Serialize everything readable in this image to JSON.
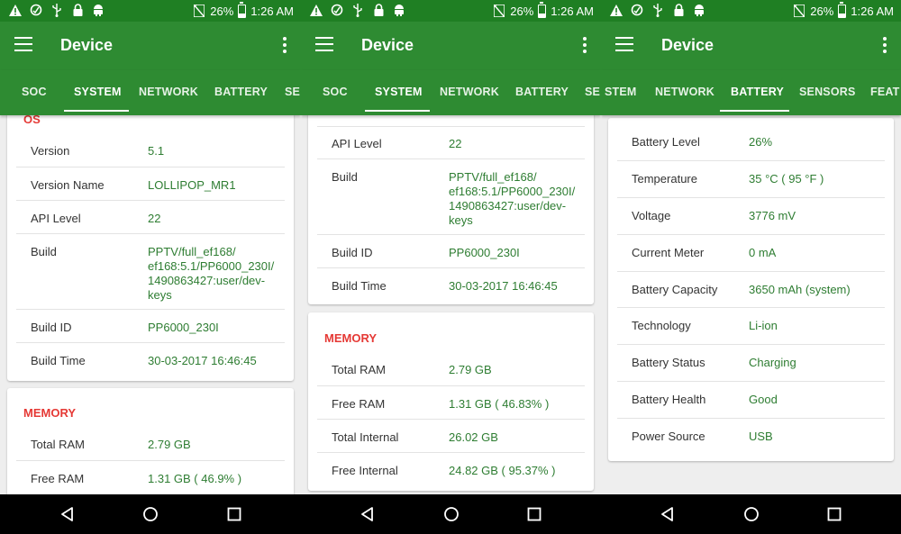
{
  "status_bar": {
    "battery_percent": "26%",
    "time": "1:26 AM",
    "icons": [
      "alert-icon",
      "data-saver-icon",
      "usb-icon",
      "lock-icon",
      "android-icon",
      "no-sim-icon",
      "battery-charging-icon"
    ]
  },
  "app_bar": {
    "title": "Device",
    "menu_icon": "hamburger-menu-icon",
    "overflow_icon": "more-vertical-icon"
  },
  "tabs": {
    "panel1": [
      "SOC",
      "SYSTEM",
      "NETWORK",
      "BATTERY",
      "SE"
    ],
    "panel2": [
      "SOC",
      "SYSTEM",
      "NETWORK",
      "BATTERY",
      "SE"
    ],
    "panel3": [
      "STEM",
      "NETWORK",
      "BATTERY",
      "SENSORS",
      "FEAT"
    ]
  },
  "panel1": {
    "os_title": "OS",
    "os_rows": [
      {
        "label": "Version",
        "value": "5.1"
      },
      {
        "label": "Version Name",
        "value": "LOLLIPOP_MR1"
      },
      {
        "label": "API Level",
        "value": "22"
      },
      {
        "label": "Build",
        "value": "PPTV/full_ef168/ ef168:5.1/PP6000_230I/ 1490863427:user/dev-keys"
      },
      {
        "label": "Build ID",
        "value": "PP6000_230I"
      },
      {
        "label": "Build Time",
        "value": "30-03-2017 16:46:45"
      }
    ],
    "memory_title": "MEMORY",
    "memory_rows": [
      {
        "label": "Total RAM",
        "value": "2.79 GB"
      },
      {
        "label": "Free RAM",
        "value": "1.31 GB ( 46.9% )"
      }
    ]
  },
  "panel2": {
    "os_rows": [
      {
        "label": "API Level",
        "value": "22"
      },
      {
        "label": "Build",
        "value": "PPTV/full_ef168/ ef168:5.1/PP6000_230I/ 1490863427:user/dev-keys"
      },
      {
        "label": "Build ID",
        "value": "PP6000_230I"
      },
      {
        "label": "Build Time",
        "value": "30-03-2017 16:46:45"
      }
    ],
    "memory_title": "MEMORY",
    "memory_rows": [
      {
        "label": "Total RAM",
        "value": "2.79 GB"
      },
      {
        "label": "Free RAM",
        "value": "1.31 GB ( 46.83% )"
      },
      {
        "label": "Total Internal",
        "value": "26.02 GB"
      },
      {
        "label": "Free Internal",
        "value": "24.82 GB ( 95.37% )"
      }
    ]
  },
  "panel3": {
    "battery_rows": [
      {
        "label": "Battery Level",
        "value": "26%"
      },
      {
        "label": "Temperature",
        "value": "35 °C  ( 95 °F )"
      },
      {
        "label": "Voltage",
        "value": "3776 mV"
      },
      {
        "label": "Current Meter",
        "value": "0 mA"
      },
      {
        "label": "Battery Capacity",
        "value": "3650 mAh (system)"
      },
      {
        "label": "Technology",
        "value": "Li-ion"
      },
      {
        "label": "Battery Status",
        "value": "Charging"
      },
      {
        "label": "Battery Health",
        "value": "Good"
      },
      {
        "label": "Power Source",
        "value": "USB"
      }
    ]
  },
  "nav_bar": {
    "icons": [
      "back-icon",
      "home-icon",
      "recents-icon"
    ]
  },
  "colors": {
    "status_bar": "#1f7f23",
    "app_bar": "#2e8b32",
    "section_title": "#e53935",
    "value_text": "#2e7d32"
  }
}
